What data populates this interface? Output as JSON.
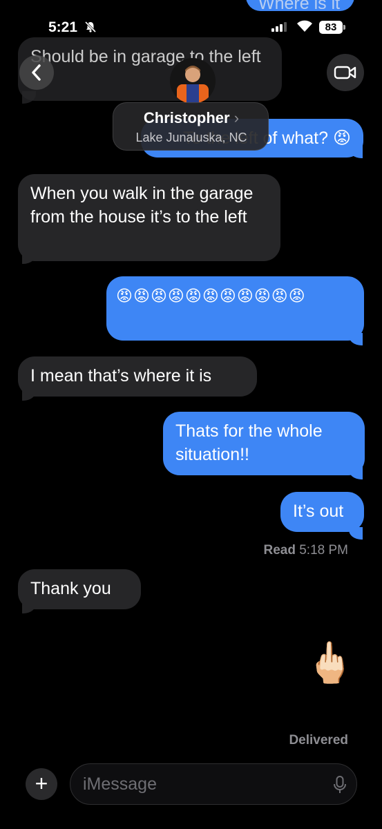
{
  "status_bar": {
    "time": "5:21",
    "battery": "83"
  },
  "contact": {
    "name": "Christopher",
    "chevron": "›",
    "location": "Lake Junaluska, NC"
  },
  "messages": [
    {
      "id": "m0",
      "from": "me",
      "text": "Where is it"
    },
    {
      "id": "m1",
      "from": "them",
      "text": "Should be in garage to the left"
    },
    {
      "id": "m2",
      "from": "me",
      "text": "To the left of what? 😡"
    },
    {
      "id": "m3",
      "from": "them",
      "text": "When you walk in the garage from the house it’s to the left"
    },
    {
      "id": "m4",
      "from": "me",
      "text": "😡😡😡😡😡😡😡😡😡😡😡"
    },
    {
      "id": "m5",
      "from": "them",
      "text": "I mean that’s where it is"
    },
    {
      "id": "m6",
      "from": "me",
      "text": "Thats for the whole situation!!"
    },
    {
      "id": "m7",
      "from": "me",
      "text": "It’s out"
    },
    {
      "id": "m8",
      "from": "them",
      "text": "Thank you"
    },
    {
      "id": "m9",
      "from": "me",
      "text": "🖕🏻"
    }
  ],
  "read_receipt": {
    "label": "Read",
    "time": "5:18 PM"
  },
  "delivered_label": "Delivered",
  "composer": {
    "placeholder": "iMessage"
  },
  "icons": [
    "back-chevron-icon",
    "video-camera-icon",
    "plus-icon",
    "microphone-icon",
    "silent-bell-icon",
    "cellular-signal-icon",
    "wifi-icon",
    "battery-icon"
  ],
  "colors": {
    "outgoing_bubble": "#3e86f5",
    "incoming_bubble": "#262628",
    "background": "#000000"
  }
}
